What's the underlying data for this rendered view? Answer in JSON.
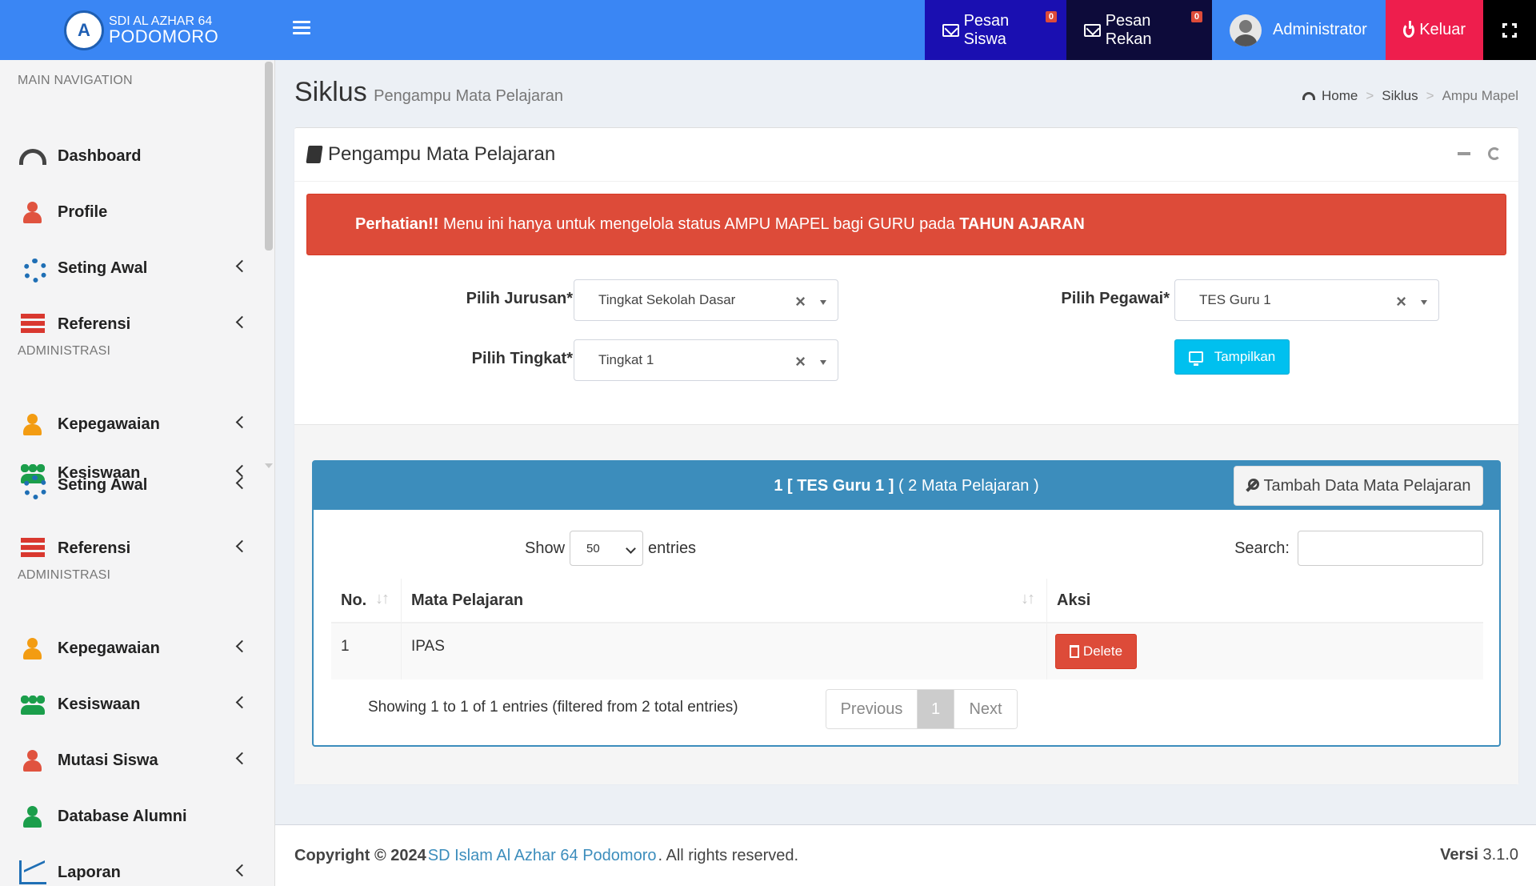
{
  "header": {
    "logo_line1": "SDI AL AZHAR 64",
    "logo_line2": "PODOMORO",
    "nav": {
      "pesan_siswa": "Pesan Siswa",
      "pesan_siswa_count": "0",
      "pesan_rekan": "Pesan Rekan",
      "pesan_rekan_count": "0",
      "user": "Administrator",
      "logout": "Keluar"
    },
    "colors": {
      "header": "#3a86f4",
      "pesan_siswa": "#1a0fb1",
      "pesan_rekan": "#0d0b3a",
      "keluar": "#ee1e4d"
    }
  },
  "sidebar": {
    "section_main": "MAIN NAVIGATION",
    "items_main": [
      {
        "label": "Dashboard",
        "icon": "dashboard-icon"
      },
      {
        "label": "Profile",
        "icon": "user-icon"
      },
      {
        "label": "Seting Awal",
        "icon": "gear-icon"
      },
      {
        "label": "Referensi",
        "icon": "list-icon"
      }
    ],
    "section_admin": "ADMINISTRASI",
    "items_admin": [
      {
        "label": "Kepegawaian",
        "icon": "user-tie-icon"
      },
      {
        "label": "Kesiswaan",
        "icon": "users-icon"
      },
      {
        "label": "Seting Awal",
        "icon": "gear-icon"
      },
      {
        "label": "Referensi",
        "icon": "list-icon"
      }
    ],
    "section_admin2": "ADMINISTRASI",
    "items_admin2": [
      {
        "label": "Kepegawaian",
        "icon": "user-tie-icon"
      },
      {
        "label": "Kesiswaan",
        "icon": "users-icon"
      },
      {
        "label": "Mutasi Siswa",
        "icon": "user-move-icon"
      },
      {
        "label": "Database Alumni",
        "icon": "graduate-icon"
      },
      {
        "label": "Laporan",
        "icon": "line-chart-icon"
      }
    ]
  },
  "content": {
    "title": "Siklus",
    "subtitle": "Pengampu Mata Pelajaran",
    "breadcrumb": [
      "Home",
      "Siklus",
      "Ampu Mapel"
    ]
  },
  "box": {
    "title": "Pengampu Mata Pelajaran",
    "alert_bold": "Perhatian!!",
    "alert_text": " Menu ini hanya untuk mengelola status AMPU MAPEL bagi GURU pada ",
    "alert_bold2": "TAHUN AJARAN",
    "form": {
      "jurusan_label": "Pilih Jurusan*",
      "jurusan_value": "Tingkat Sekolah Dasar",
      "tingkat_label": "Pilih Tingkat*",
      "tingkat_value": "Tingkat 1",
      "pegawai_label": "Pilih Pegawai*",
      "pegawai_value": "TES Guru 1",
      "submit_label": "Tampilkan"
    }
  },
  "panel": {
    "heading_bold": "1 [ TES Guru 1 ]",
    "heading_rest": " ( 2 Mata Pelajaran )",
    "add_button": "Tambah Data Mata Pelajaran",
    "show_label": "Show",
    "entries_value": "50",
    "entries_label": "entries",
    "search_label": "Search:",
    "columns": [
      "No.",
      "Mata Pelajaran",
      "Aksi"
    ],
    "rows": [
      {
        "no": "1",
        "mapel": "IPAS",
        "action": "Delete"
      }
    ],
    "info": "Showing 1 to 1 of 1 entries (filtered from 2 total entries)",
    "pagination": {
      "prev": "Previous",
      "current": "1",
      "next": "Next"
    }
  },
  "footer": {
    "copyright_prefix": "Copyright © 2024",
    "org": "SD Islam Al Azhar 64 Podomoro",
    "suffix": ". All rights reserved.",
    "version_label": "Versi",
    "version": "3.1.0"
  }
}
